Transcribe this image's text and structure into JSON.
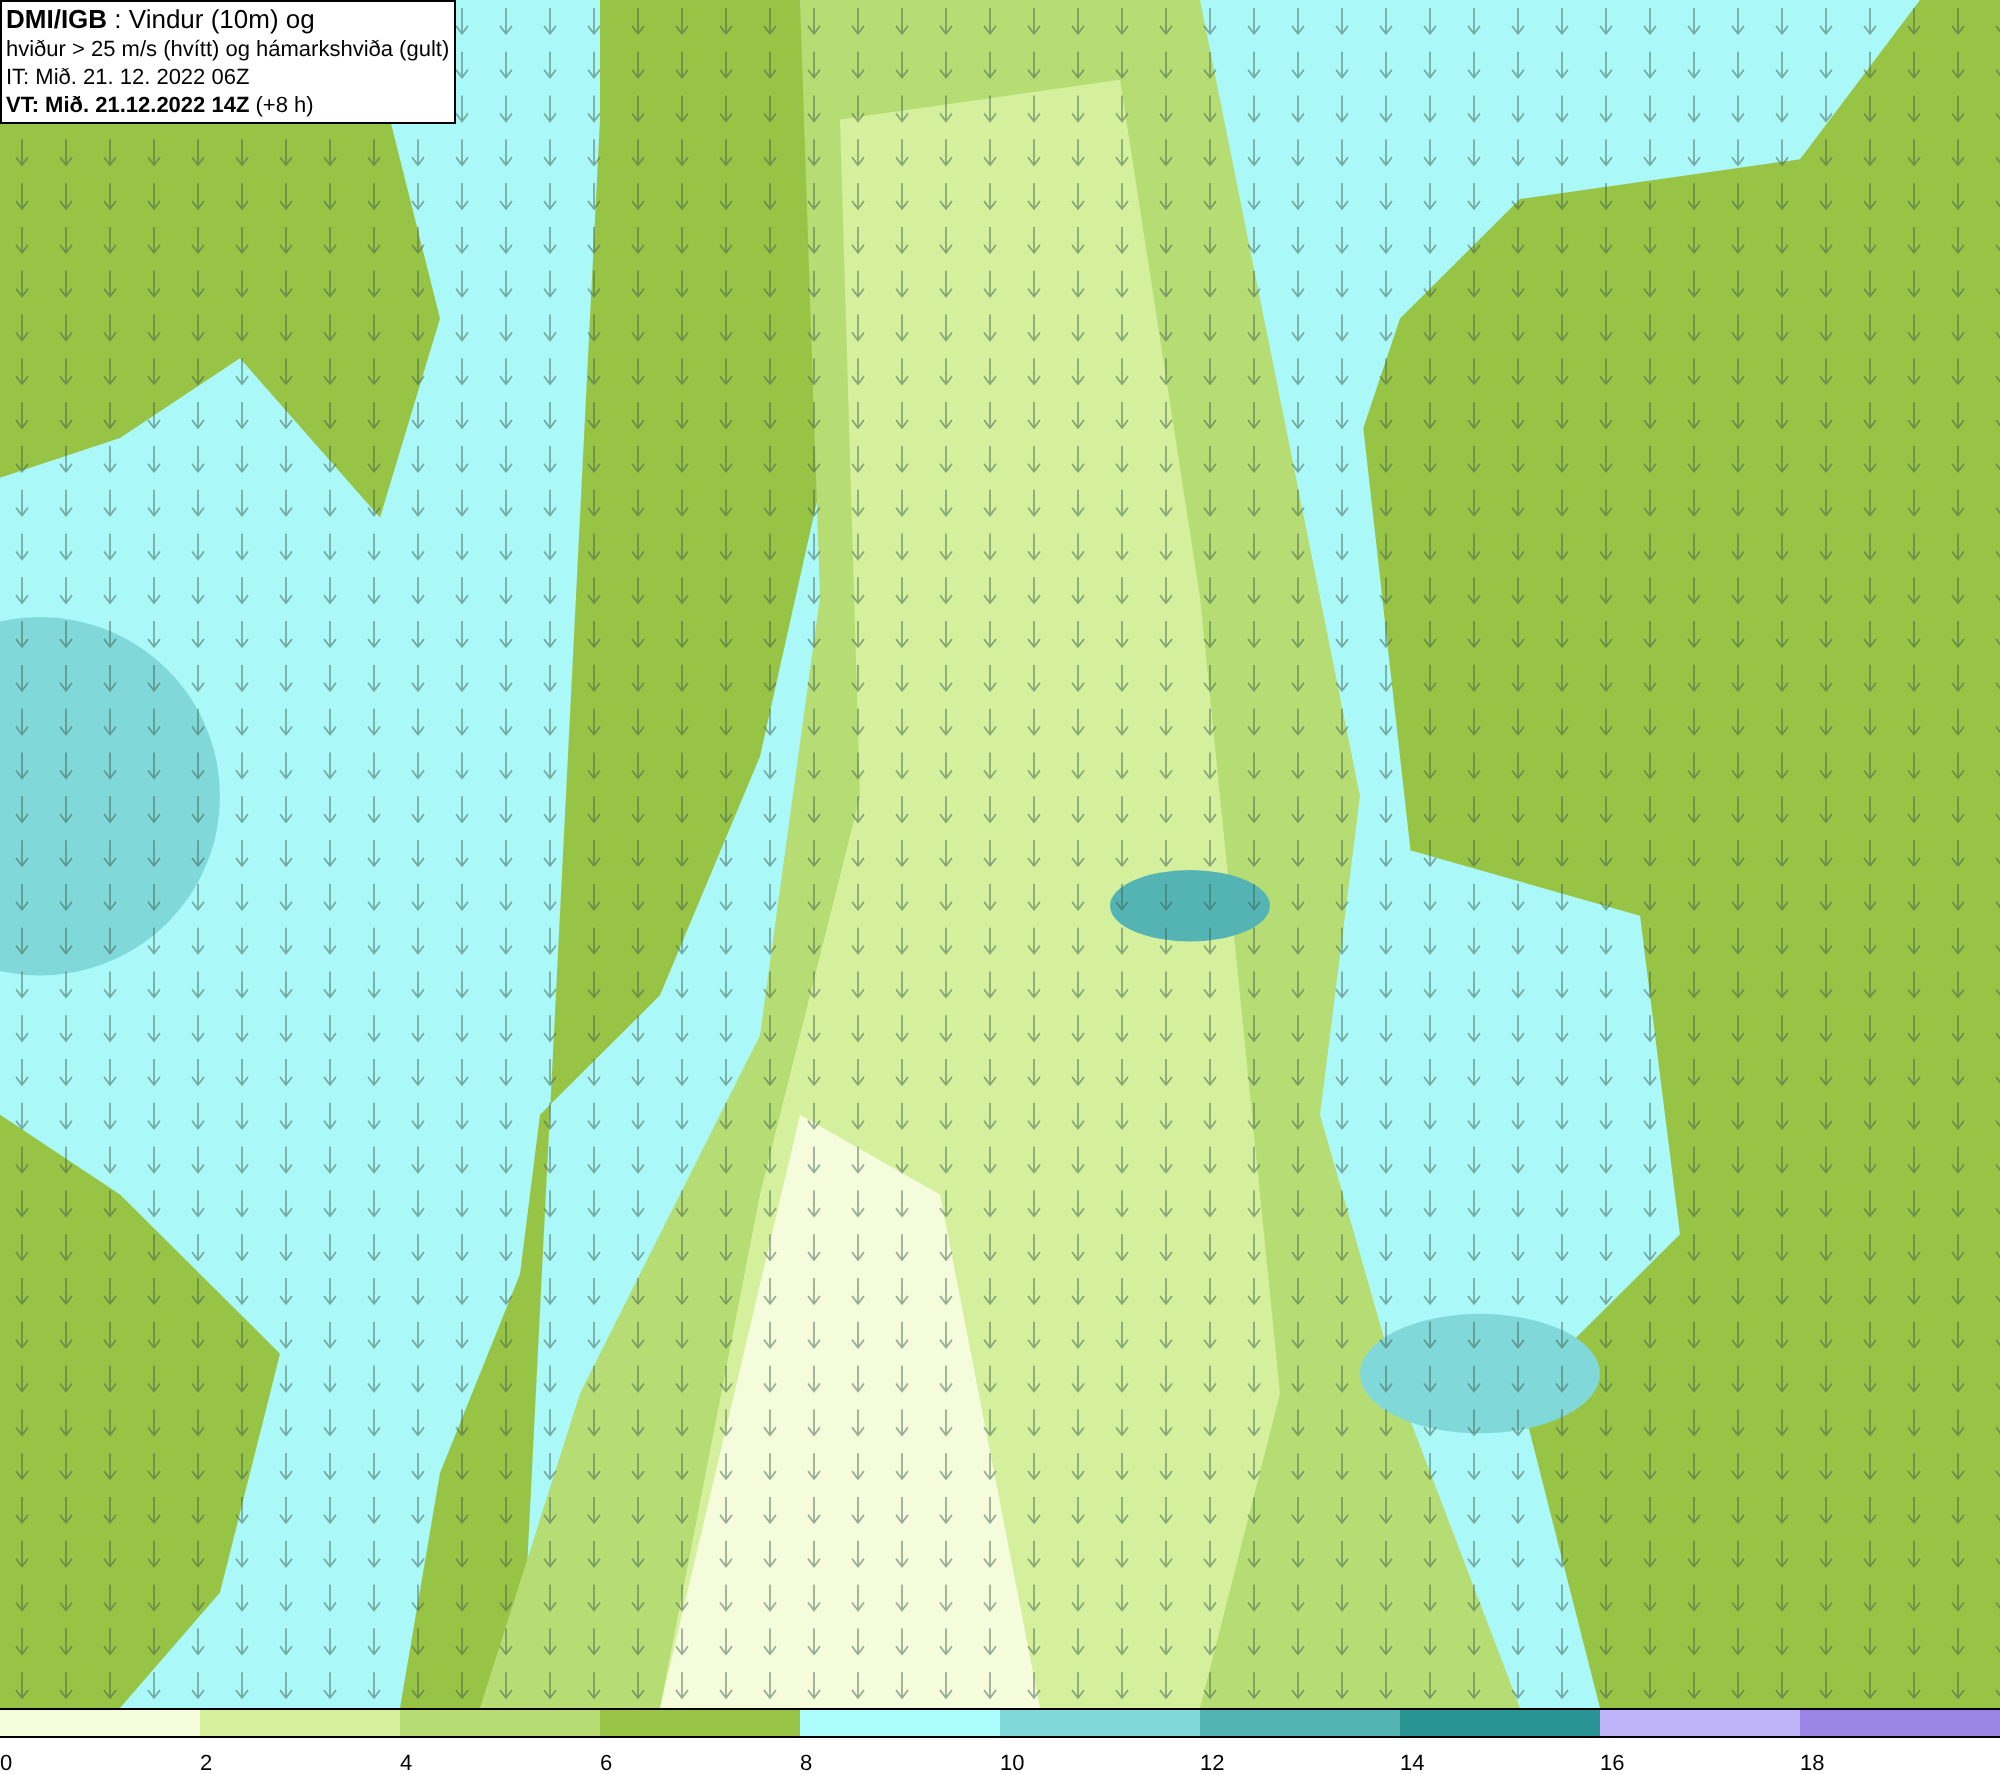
{
  "header": {
    "lines": [
      "**DMI/IGB** : Vindur (10m) og",
      "hviður > 25 m/s (hvítt) og hámarkshviða (gult)",
      "IT: Mið. 21. 12. 2022 06Z",
      "**VT: Mið. 21.12.2022 14Z** (+8 h)"
    ]
  },
  "legend": {
    "bins": [
      {
        "label": "0",
        "color": "#f4fcdc"
      },
      {
        "label": "2",
        "color": "#d4f09c"
      },
      {
        "label": "4",
        "color": "#b6dc74"
      },
      {
        "label": "6",
        "color": "#98c446"
      },
      {
        "label": "8",
        "color": "#acfcfc"
      },
      {
        "label": "10",
        "color": "#80d8d8"
      },
      {
        "label": "12",
        "color": "#54b4b4"
      },
      {
        "label": "14",
        "color": "#289494"
      },
      {
        "label": "16",
        "color": "#c0b4f8"
      },
      {
        "label": "18",
        "color": "#9c84e4"
      }
    ]
  }
}
